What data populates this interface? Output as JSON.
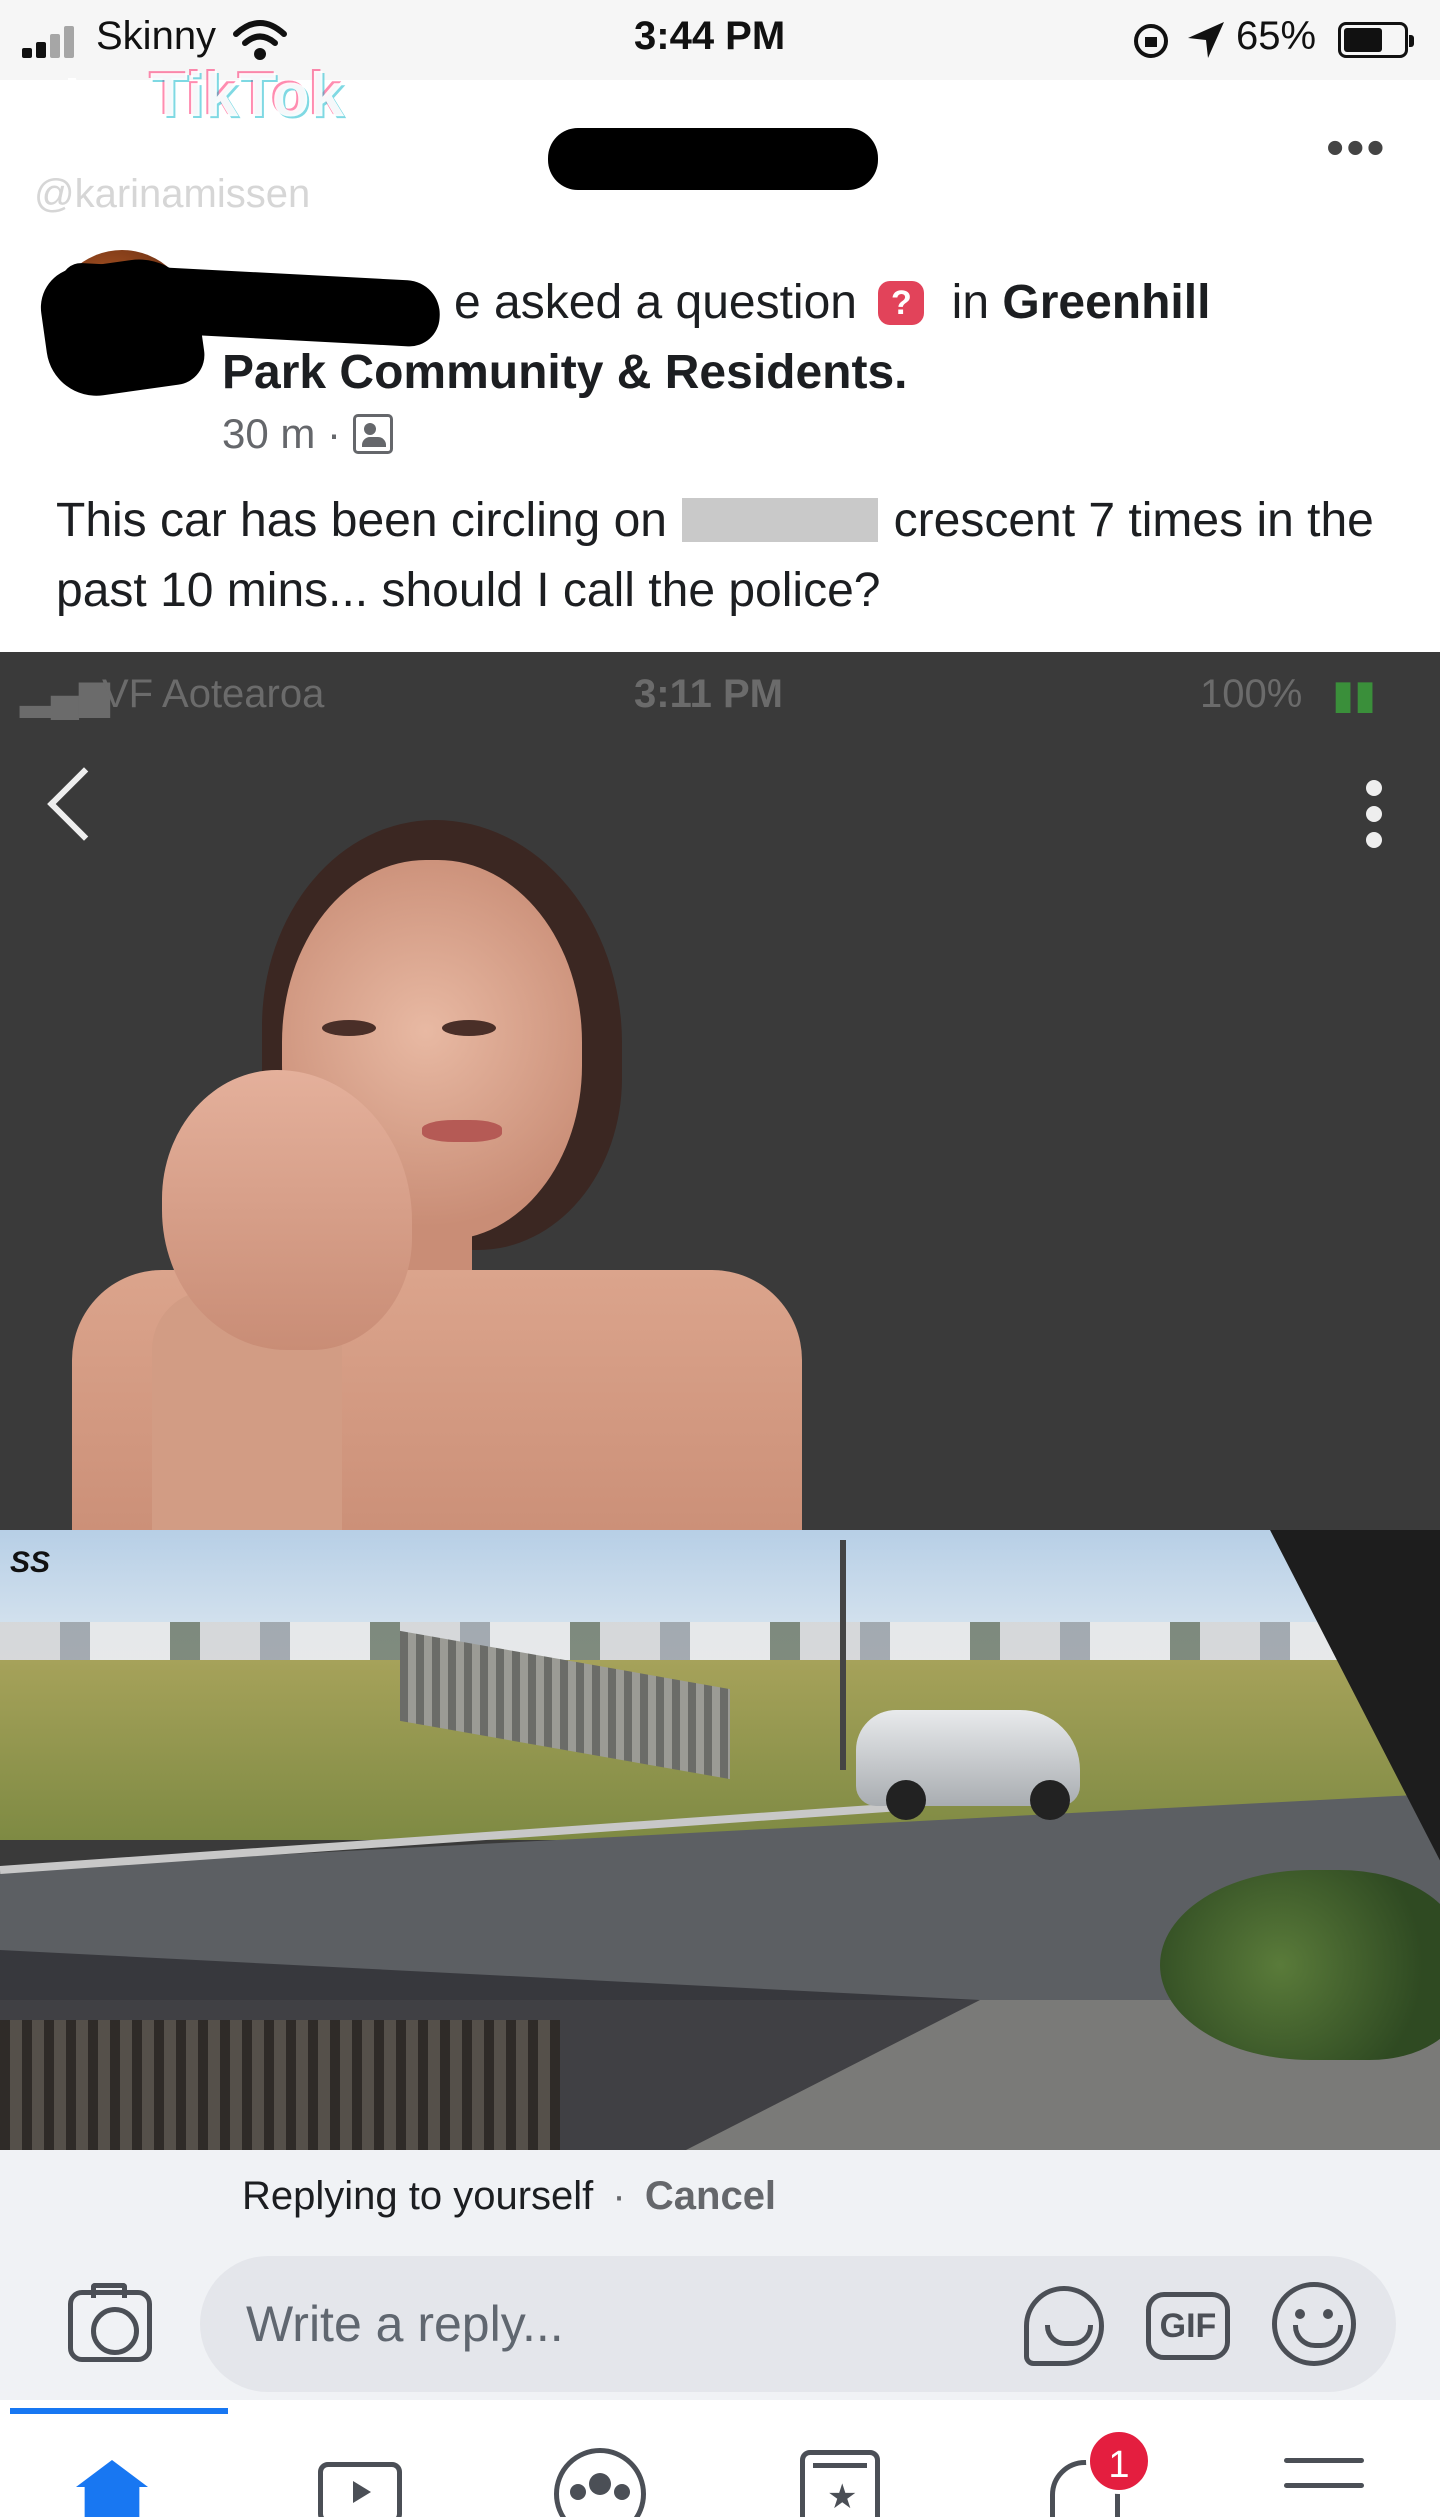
{
  "status_bar": {
    "carrier": "Skinny",
    "time": "3:44 PM",
    "battery": "65%",
    "battery_level": 0.65
  },
  "watermark": {
    "brand": "TikTok",
    "username": "@karinamissen"
  },
  "header": {
    "more_label": "•••"
  },
  "post": {
    "author_suffix": "e",
    "action": "asked a question",
    "question_badge": "?",
    "group_prefix": "in",
    "group_name_1": "Greenhill",
    "group_name_2": "Park Community & Residents.",
    "timestamp": "30 m",
    "meta_sep": "·",
    "body_1": "This car has been circling on",
    "body_2": "crescent 7 times in the past 10 mins... should I call the police?"
  },
  "inner_screenshot": {
    "carrier": "VF Aotearoa",
    "time": "3:11 PM",
    "battery": "100%"
  },
  "reply": {
    "replying_label": "Replying to yourself",
    "separator": "·",
    "cancel_label": "Cancel",
    "input_placeholder": "Write a reply...",
    "gif_label": "GIF"
  },
  "tabs": {
    "notifications_badge": "1"
  },
  "colors": {
    "accent": "#1877f2",
    "badge": "#e41e3f",
    "question": "#e2435a"
  }
}
